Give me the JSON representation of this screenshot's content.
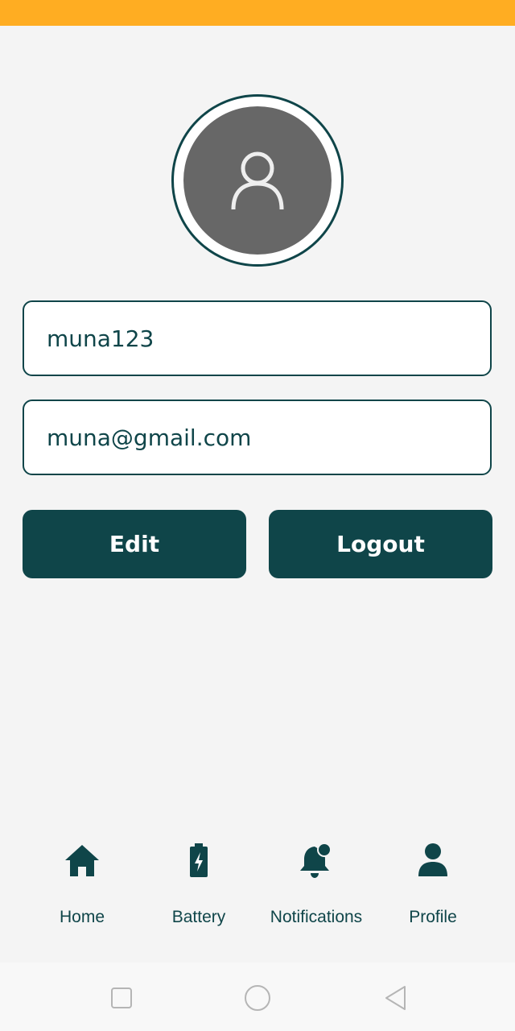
{
  "profile": {
    "username": "muna123",
    "email": "muna@gmail.com",
    "avatar_icon": "user-outline-icon"
  },
  "actions": {
    "edit_label": "Edit",
    "logout_label": "Logout"
  },
  "nav": {
    "items": [
      {
        "label": "Home",
        "icon": "home-icon"
      },
      {
        "label": "Battery",
        "icon": "battery-charging-icon"
      },
      {
        "label": "Notifications",
        "icon": "bell-dot-icon"
      },
      {
        "label": "Profile",
        "icon": "person-icon"
      }
    ]
  },
  "system_nav": [
    "recent-apps-icon",
    "home-circle-icon",
    "back-triangle-icon"
  ],
  "colors": {
    "status_bar": "#ffad22",
    "primary": "#0f4549",
    "avatar_bg": "#676767",
    "background": "#f4f4f4"
  }
}
